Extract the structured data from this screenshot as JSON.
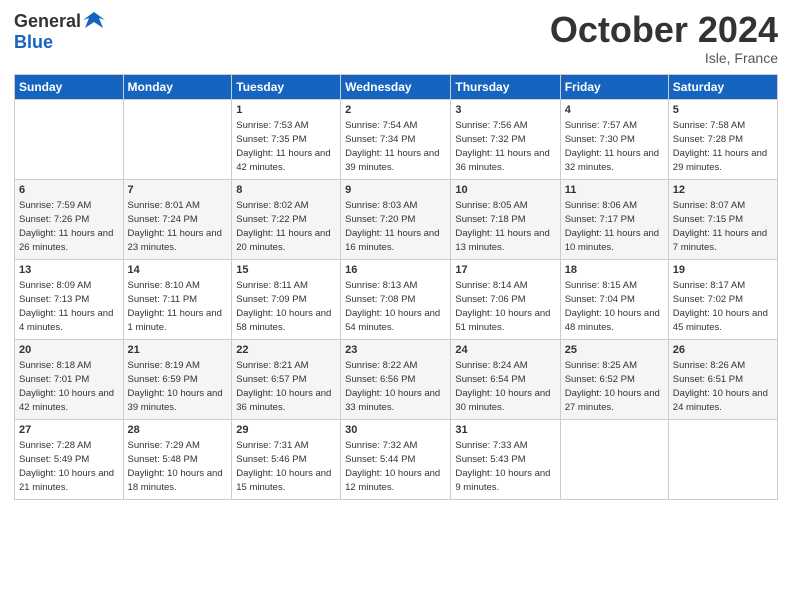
{
  "header": {
    "logo_general": "General",
    "logo_blue": "Blue",
    "month_title": "October 2024",
    "subtitle": "Isle, France"
  },
  "days_of_week": [
    "Sunday",
    "Monday",
    "Tuesday",
    "Wednesday",
    "Thursday",
    "Friday",
    "Saturday"
  ],
  "weeks": [
    [
      {
        "day": null
      },
      {
        "day": null
      },
      {
        "day": 1,
        "sunrise": "Sunrise: 7:53 AM",
        "sunset": "Sunset: 7:35 PM",
        "daylight": "Daylight: 11 hours and 42 minutes."
      },
      {
        "day": 2,
        "sunrise": "Sunrise: 7:54 AM",
        "sunset": "Sunset: 7:34 PM",
        "daylight": "Daylight: 11 hours and 39 minutes."
      },
      {
        "day": 3,
        "sunrise": "Sunrise: 7:56 AM",
        "sunset": "Sunset: 7:32 PM",
        "daylight": "Daylight: 11 hours and 36 minutes."
      },
      {
        "day": 4,
        "sunrise": "Sunrise: 7:57 AM",
        "sunset": "Sunset: 7:30 PM",
        "daylight": "Daylight: 11 hours and 32 minutes."
      },
      {
        "day": 5,
        "sunrise": "Sunrise: 7:58 AM",
        "sunset": "Sunset: 7:28 PM",
        "daylight": "Daylight: 11 hours and 29 minutes."
      }
    ],
    [
      {
        "day": 6,
        "sunrise": "Sunrise: 7:59 AM",
        "sunset": "Sunset: 7:26 PM",
        "daylight": "Daylight: 11 hours and 26 minutes."
      },
      {
        "day": 7,
        "sunrise": "Sunrise: 8:01 AM",
        "sunset": "Sunset: 7:24 PM",
        "daylight": "Daylight: 11 hours and 23 minutes."
      },
      {
        "day": 8,
        "sunrise": "Sunrise: 8:02 AM",
        "sunset": "Sunset: 7:22 PM",
        "daylight": "Daylight: 11 hours and 20 minutes."
      },
      {
        "day": 9,
        "sunrise": "Sunrise: 8:03 AM",
        "sunset": "Sunset: 7:20 PM",
        "daylight": "Daylight: 11 hours and 16 minutes."
      },
      {
        "day": 10,
        "sunrise": "Sunrise: 8:05 AM",
        "sunset": "Sunset: 7:18 PM",
        "daylight": "Daylight: 11 hours and 13 minutes."
      },
      {
        "day": 11,
        "sunrise": "Sunrise: 8:06 AM",
        "sunset": "Sunset: 7:17 PM",
        "daylight": "Daylight: 11 hours and 10 minutes."
      },
      {
        "day": 12,
        "sunrise": "Sunrise: 8:07 AM",
        "sunset": "Sunset: 7:15 PM",
        "daylight": "Daylight: 11 hours and 7 minutes."
      }
    ],
    [
      {
        "day": 13,
        "sunrise": "Sunrise: 8:09 AM",
        "sunset": "Sunset: 7:13 PM",
        "daylight": "Daylight: 11 hours and 4 minutes."
      },
      {
        "day": 14,
        "sunrise": "Sunrise: 8:10 AM",
        "sunset": "Sunset: 7:11 PM",
        "daylight": "Daylight: 11 hours and 1 minute."
      },
      {
        "day": 15,
        "sunrise": "Sunrise: 8:11 AM",
        "sunset": "Sunset: 7:09 PM",
        "daylight": "Daylight: 10 hours and 58 minutes."
      },
      {
        "day": 16,
        "sunrise": "Sunrise: 8:13 AM",
        "sunset": "Sunset: 7:08 PM",
        "daylight": "Daylight: 10 hours and 54 minutes."
      },
      {
        "day": 17,
        "sunrise": "Sunrise: 8:14 AM",
        "sunset": "Sunset: 7:06 PM",
        "daylight": "Daylight: 10 hours and 51 minutes."
      },
      {
        "day": 18,
        "sunrise": "Sunrise: 8:15 AM",
        "sunset": "Sunset: 7:04 PM",
        "daylight": "Daylight: 10 hours and 48 minutes."
      },
      {
        "day": 19,
        "sunrise": "Sunrise: 8:17 AM",
        "sunset": "Sunset: 7:02 PM",
        "daylight": "Daylight: 10 hours and 45 minutes."
      }
    ],
    [
      {
        "day": 20,
        "sunrise": "Sunrise: 8:18 AM",
        "sunset": "Sunset: 7:01 PM",
        "daylight": "Daylight: 10 hours and 42 minutes."
      },
      {
        "day": 21,
        "sunrise": "Sunrise: 8:19 AM",
        "sunset": "Sunset: 6:59 PM",
        "daylight": "Daylight: 10 hours and 39 minutes."
      },
      {
        "day": 22,
        "sunrise": "Sunrise: 8:21 AM",
        "sunset": "Sunset: 6:57 PM",
        "daylight": "Daylight: 10 hours and 36 minutes."
      },
      {
        "day": 23,
        "sunrise": "Sunrise: 8:22 AM",
        "sunset": "Sunset: 6:56 PM",
        "daylight": "Daylight: 10 hours and 33 minutes."
      },
      {
        "day": 24,
        "sunrise": "Sunrise: 8:24 AM",
        "sunset": "Sunset: 6:54 PM",
        "daylight": "Daylight: 10 hours and 30 minutes."
      },
      {
        "day": 25,
        "sunrise": "Sunrise: 8:25 AM",
        "sunset": "Sunset: 6:52 PM",
        "daylight": "Daylight: 10 hours and 27 minutes."
      },
      {
        "day": 26,
        "sunrise": "Sunrise: 8:26 AM",
        "sunset": "Sunset: 6:51 PM",
        "daylight": "Daylight: 10 hours and 24 minutes."
      }
    ],
    [
      {
        "day": 27,
        "sunrise": "Sunrise: 7:28 AM",
        "sunset": "Sunset: 5:49 PM",
        "daylight": "Daylight: 10 hours and 21 minutes."
      },
      {
        "day": 28,
        "sunrise": "Sunrise: 7:29 AM",
        "sunset": "Sunset: 5:48 PM",
        "daylight": "Daylight: 10 hours and 18 minutes."
      },
      {
        "day": 29,
        "sunrise": "Sunrise: 7:31 AM",
        "sunset": "Sunset: 5:46 PM",
        "daylight": "Daylight: 10 hours and 15 minutes."
      },
      {
        "day": 30,
        "sunrise": "Sunrise: 7:32 AM",
        "sunset": "Sunset: 5:44 PM",
        "daylight": "Daylight: 10 hours and 12 minutes."
      },
      {
        "day": 31,
        "sunrise": "Sunrise: 7:33 AM",
        "sunset": "Sunset: 5:43 PM",
        "daylight": "Daylight: 10 hours and 9 minutes."
      },
      {
        "day": null
      },
      {
        "day": null
      }
    ]
  ]
}
